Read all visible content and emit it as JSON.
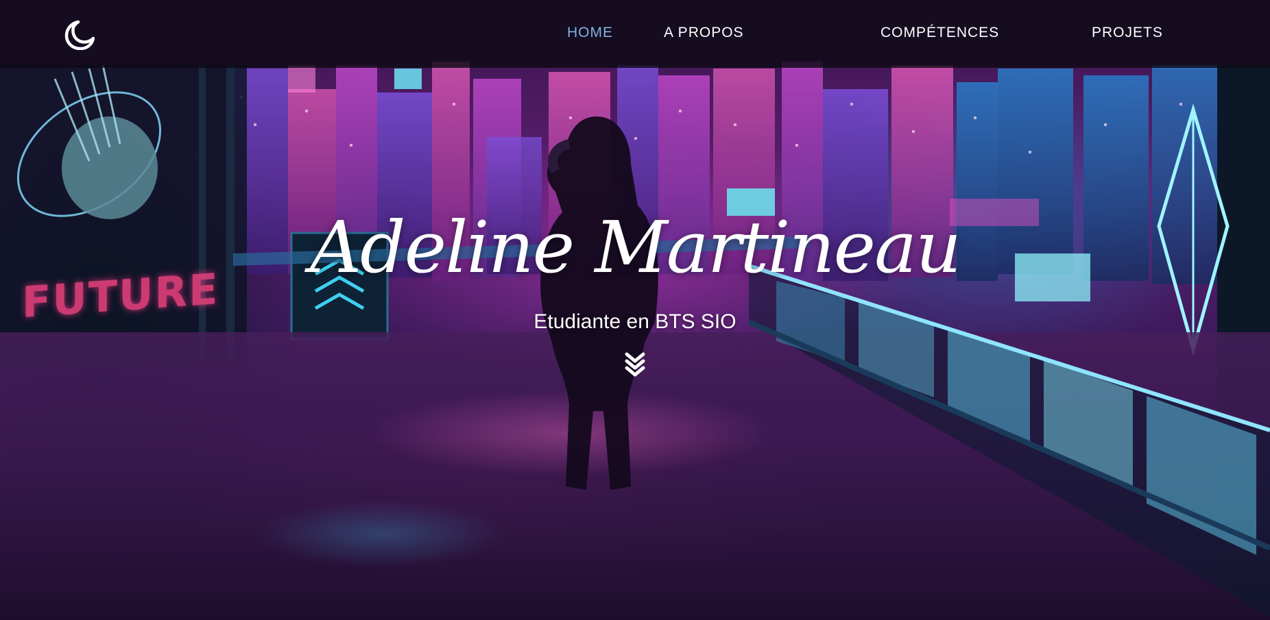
{
  "navbar": {
    "theme_toggle_icon": "moon-icon",
    "links": [
      {
        "label": "HOME",
        "active": true
      },
      {
        "label": "A PROPOS",
        "active": false
      },
      {
        "label": "COMPÉTENCES",
        "active": false
      },
      {
        "label": "PROJETS",
        "active": false
      }
    ]
  },
  "hero": {
    "title": "Adeline Martineau",
    "subtitle": "Etudiante en BTS SIO",
    "scroll_icon": "double-chevron-down-icon",
    "background_sign": "FUTURE"
  },
  "colors": {
    "nav_background": "#0c0a14",
    "nav_text": "#ffffff",
    "nav_active": "#7fb2e0",
    "hero_text": "#ffffff",
    "neon_pink": "#e0407a",
    "neon_cyan": "#3fd0f0"
  }
}
